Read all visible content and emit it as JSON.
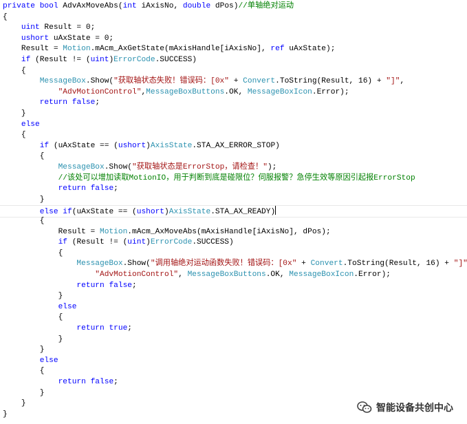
{
  "code": {
    "lines": [
      {
        "tokens": [
          {
            "t": "private",
            "c": "kw"
          },
          {
            "t": " ",
            "c": "pl"
          },
          {
            "t": "bool",
            "c": "kw"
          },
          {
            "t": " AdvAxMoveAbs(",
            "c": "pl"
          },
          {
            "t": "int",
            "c": "kw"
          },
          {
            "t": " iAxisNo, ",
            "c": "pl"
          },
          {
            "t": "double",
            "c": "kw"
          },
          {
            "t": " dPos)",
            "c": "pl"
          },
          {
            "t": "//单轴绝对运动",
            "c": "cm"
          }
        ]
      },
      {
        "tokens": [
          {
            "t": "{",
            "c": "pl"
          }
        ]
      },
      {
        "tokens": [
          {
            "t": "    ",
            "c": "pl"
          },
          {
            "t": "uint",
            "c": "kw"
          },
          {
            "t": " Result = 0;",
            "c": "pl"
          }
        ]
      },
      {
        "tokens": [
          {
            "t": "    ",
            "c": "pl"
          },
          {
            "t": "ushort",
            "c": "kw"
          },
          {
            "t": " uAxState = 0;",
            "c": "pl"
          }
        ]
      },
      {
        "tokens": [
          {
            "t": "    Result = ",
            "c": "pl"
          },
          {
            "t": "Motion",
            "c": "ty"
          },
          {
            "t": ".mAcm_AxGetState(mAxisHandle[iAxisNo], ",
            "c": "pl"
          },
          {
            "t": "ref",
            "c": "kw"
          },
          {
            "t": " uAxState);",
            "c": "pl"
          }
        ]
      },
      {
        "tokens": [
          {
            "t": "    ",
            "c": "pl"
          },
          {
            "t": "if",
            "c": "kw"
          },
          {
            "t": " (Result != (",
            "c": "pl"
          },
          {
            "t": "uint",
            "c": "kw"
          },
          {
            "t": ")",
            "c": "pl"
          },
          {
            "t": "ErrorCode",
            "c": "ty"
          },
          {
            "t": ".SUCCESS)",
            "c": "pl"
          }
        ]
      },
      {
        "tokens": [
          {
            "t": "    {",
            "c": "pl"
          }
        ]
      },
      {
        "tokens": [
          {
            "t": "        ",
            "c": "pl"
          },
          {
            "t": "MessageBox",
            "c": "ty"
          },
          {
            "t": ".Show(",
            "c": "pl"
          },
          {
            "t": "\"获取轴状态失败！错误码：[0x\"",
            "c": "str"
          },
          {
            "t": " + ",
            "c": "pl"
          },
          {
            "t": "Convert",
            "c": "ty"
          },
          {
            "t": ".ToString(Result, 16) + ",
            "c": "pl"
          },
          {
            "t": "\"]\"",
            "c": "str"
          },
          {
            "t": ",",
            "c": "pl"
          }
        ]
      },
      {
        "tokens": [
          {
            "t": "            ",
            "c": "pl"
          },
          {
            "t": "\"AdvMotionControl\"",
            "c": "str"
          },
          {
            "t": ",",
            "c": "pl"
          },
          {
            "t": "MessageBoxButtons",
            "c": "ty"
          },
          {
            "t": ".OK, ",
            "c": "pl"
          },
          {
            "t": "MessageBoxIcon",
            "c": "ty"
          },
          {
            "t": ".Error);",
            "c": "pl"
          }
        ]
      },
      {
        "tokens": [
          {
            "t": "        ",
            "c": "pl"
          },
          {
            "t": "return",
            "c": "kw"
          },
          {
            "t": " ",
            "c": "pl"
          },
          {
            "t": "false",
            "c": "kw"
          },
          {
            "t": ";",
            "c": "pl"
          }
        ]
      },
      {
        "tokens": [
          {
            "t": "    }",
            "c": "pl"
          }
        ]
      },
      {
        "tokens": [
          {
            "t": "    ",
            "c": "pl"
          },
          {
            "t": "else",
            "c": "kw"
          }
        ]
      },
      {
        "tokens": [
          {
            "t": "    {",
            "c": "pl"
          }
        ]
      },
      {
        "tokens": [
          {
            "t": "        ",
            "c": "pl"
          },
          {
            "t": "if",
            "c": "kw"
          },
          {
            "t": " (uAxState == (",
            "c": "pl"
          },
          {
            "t": "ushort",
            "c": "kw"
          },
          {
            "t": ")",
            "c": "pl"
          },
          {
            "t": "AxisState",
            "c": "ty"
          },
          {
            "t": ".STA_AX_ERROR_STOP)",
            "c": "pl"
          }
        ]
      },
      {
        "tokens": [
          {
            "t": "        {",
            "c": "pl"
          }
        ]
      },
      {
        "tokens": [
          {
            "t": "            ",
            "c": "pl"
          },
          {
            "t": "MessageBox",
            "c": "ty"
          },
          {
            "t": ".Show(",
            "c": "pl"
          },
          {
            "t": "\"获取轴状态是ErrorStop，请检查！\"",
            "c": "str"
          },
          {
            "t": ");",
            "c": "pl"
          }
        ]
      },
      {
        "tokens": [
          {
            "t": "            ",
            "c": "pl"
          },
          {
            "t": "//该处可以增加读取MotionIO，用于判断到底是碰限位？伺服报警？急停生效等原因引起报ErrorStop",
            "c": "cm"
          }
        ]
      },
      {
        "tokens": [
          {
            "t": "            ",
            "c": "pl"
          },
          {
            "t": "return",
            "c": "kw"
          },
          {
            "t": " ",
            "c": "pl"
          },
          {
            "t": "false",
            "c": "kw"
          },
          {
            "t": ";",
            "c": "pl"
          }
        ]
      },
      {
        "tokens": [
          {
            "t": "        }",
            "c": "pl"
          }
        ]
      },
      {
        "highlight": true,
        "caret": true,
        "tokens": [
          {
            "t": "        ",
            "c": "pl"
          },
          {
            "t": "else",
            "c": "kw"
          },
          {
            "t": " ",
            "c": "pl"
          },
          {
            "t": "if",
            "c": "kw"
          },
          {
            "t": "(uAxState == (",
            "c": "pl"
          },
          {
            "t": "ushort",
            "c": "kw"
          },
          {
            "t": ")",
            "c": "pl"
          },
          {
            "t": "AxisState",
            "c": "ty"
          },
          {
            "t": ".STA_AX_READY)",
            "c": "pl"
          }
        ]
      },
      {
        "tokens": [
          {
            "t": "        {",
            "c": "pl"
          }
        ]
      },
      {
        "tokens": [
          {
            "t": "            Result = ",
            "c": "pl"
          },
          {
            "t": "Motion",
            "c": "ty"
          },
          {
            "t": ".mAcm_AxMoveAbs(mAxisHandle[iAxisNo], dPos);",
            "c": "pl"
          }
        ]
      },
      {
        "tokens": [
          {
            "t": "            ",
            "c": "pl"
          },
          {
            "t": "if",
            "c": "kw"
          },
          {
            "t": " (Result != (",
            "c": "pl"
          },
          {
            "t": "uint",
            "c": "kw"
          },
          {
            "t": ")",
            "c": "pl"
          },
          {
            "t": "ErrorCode",
            "c": "ty"
          },
          {
            "t": ".SUCCESS)",
            "c": "pl"
          }
        ]
      },
      {
        "tokens": [
          {
            "t": "            {",
            "c": "pl"
          }
        ]
      },
      {
        "tokens": [
          {
            "t": "                ",
            "c": "pl"
          },
          {
            "t": "MessageBox",
            "c": "ty"
          },
          {
            "t": ".Show(",
            "c": "pl"
          },
          {
            "t": "\"调用轴绝对运动函数失败！错误码：[0x\"",
            "c": "str"
          },
          {
            "t": " + ",
            "c": "pl"
          },
          {
            "t": "Convert",
            "c": "ty"
          },
          {
            "t": ".ToString(Result, 16) + ",
            "c": "pl"
          },
          {
            "t": "\"]\"",
            "c": "str"
          },
          {
            "t": ",",
            "c": "pl"
          }
        ]
      },
      {
        "tokens": [
          {
            "t": "                    ",
            "c": "pl"
          },
          {
            "t": "\"AdvMotionControl\"",
            "c": "str"
          },
          {
            "t": ", ",
            "c": "pl"
          },
          {
            "t": "MessageBoxButtons",
            "c": "ty"
          },
          {
            "t": ".OK, ",
            "c": "pl"
          },
          {
            "t": "MessageBoxIcon",
            "c": "ty"
          },
          {
            "t": ".Error);",
            "c": "pl"
          }
        ]
      },
      {
        "tokens": [
          {
            "t": "                ",
            "c": "pl"
          },
          {
            "t": "return",
            "c": "kw"
          },
          {
            "t": " ",
            "c": "pl"
          },
          {
            "t": "false",
            "c": "kw"
          },
          {
            "t": ";",
            "c": "pl"
          }
        ]
      },
      {
        "tokens": [
          {
            "t": "            }",
            "c": "pl"
          }
        ]
      },
      {
        "tokens": [
          {
            "t": "            ",
            "c": "pl"
          },
          {
            "t": "else",
            "c": "kw"
          }
        ]
      },
      {
        "tokens": [
          {
            "t": "            {",
            "c": "pl"
          }
        ]
      },
      {
        "tokens": [
          {
            "t": "                ",
            "c": "pl"
          },
          {
            "t": "return",
            "c": "kw"
          },
          {
            "t": " ",
            "c": "pl"
          },
          {
            "t": "true",
            "c": "kw"
          },
          {
            "t": ";",
            "c": "pl"
          }
        ]
      },
      {
        "tokens": [
          {
            "t": "            }",
            "c": "pl"
          }
        ]
      },
      {
        "tokens": [
          {
            "t": "        }",
            "c": "pl"
          }
        ]
      },
      {
        "tokens": [
          {
            "t": "        ",
            "c": "pl"
          },
          {
            "t": "else",
            "c": "kw"
          }
        ]
      },
      {
        "tokens": [
          {
            "t": "        {",
            "c": "pl"
          }
        ]
      },
      {
        "tokens": [
          {
            "t": "            ",
            "c": "pl"
          },
          {
            "t": "return",
            "c": "kw"
          },
          {
            "t": " ",
            "c": "pl"
          },
          {
            "t": "false",
            "c": "kw"
          },
          {
            "t": ";",
            "c": "pl"
          }
        ]
      },
      {
        "tokens": [
          {
            "t": "        }",
            "c": "pl"
          }
        ]
      },
      {
        "tokens": [
          {
            "t": "    }",
            "c": "pl"
          }
        ]
      },
      {
        "tokens": [
          {
            "t": "}",
            "c": "pl"
          }
        ]
      }
    ]
  },
  "watermark": {
    "text": "智能设备共创中心",
    "icon": "wechat-icon"
  },
  "colors": {
    "keyword": "#0000ff",
    "type": "#2b91af",
    "string": "#a31515",
    "comment": "#008000",
    "text": "#000000",
    "background": "#ffffff"
  }
}
